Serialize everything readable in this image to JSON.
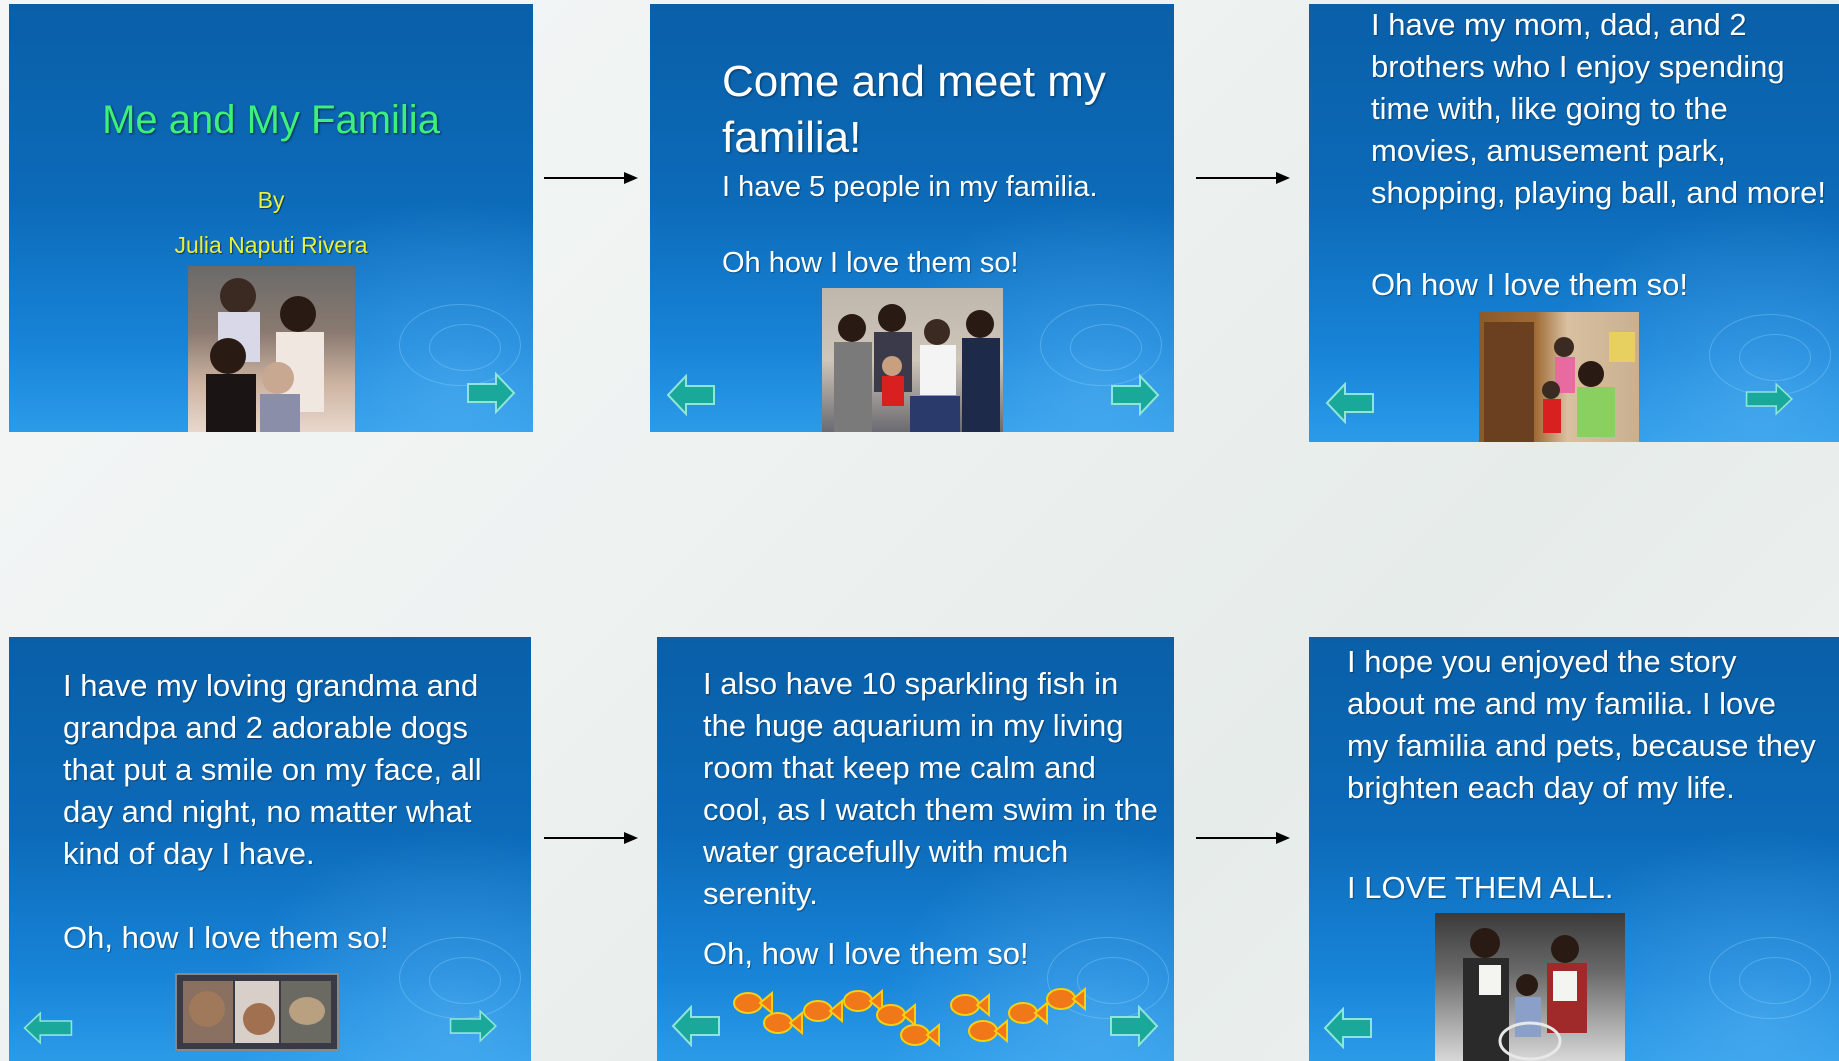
{
  "slides": {
    "s1": {
      "title": "Me and My Familia",
      "by": "By",
      "author": "Julia Naputi Rivera",
      "photo_alt": "family photo"
    },
    "s2": {
      "title": "Come and meet my familia!",
      "line1": "I have 5 people in my familia.",
      "line2": "Oh how I love them so!"
    },
    "s3": {
      "body": "I have my mom, dad, and 2 brothers who I enjoy spending time with, like going to the movies, amusement park, shopping, playing ball, and more!",
      "line2": "Oh how I love them so!"
    },
    "s4": {
      "body": "I have my loving grandma and grandpa and 2 adorable dogs that put a smile on my face, all day and night, no matter what kind of day I have.",
      "line2": "Oh, how I love them so!"
    },
    "s5": {
      "body": "I also have 10 sparkling fish in the huge aquarium in my living room that keep me calm and cool, as I watch them swim in the water gracefully with much serenity.",
      "line2": "Oh, how I love them so!"
    },
    "s6": {
      "body": "I hope you enjoyed the story about me and my familia.  I love my familia and pets, because they brighten each day of my life.",
      "line2": "I LOVE THEM ALL."
    }
  },
  "colors": {
    "title_green": "#3df07a",
    "author_yellow": "#e8f03a",
    "nav_arrow": "#1aa89a"
  },
  "icons": {
    "next": "right-arrow-icon",
    "prev": "left-arrow-icon",
    "fish": "goldfish-icon"
  }
}
